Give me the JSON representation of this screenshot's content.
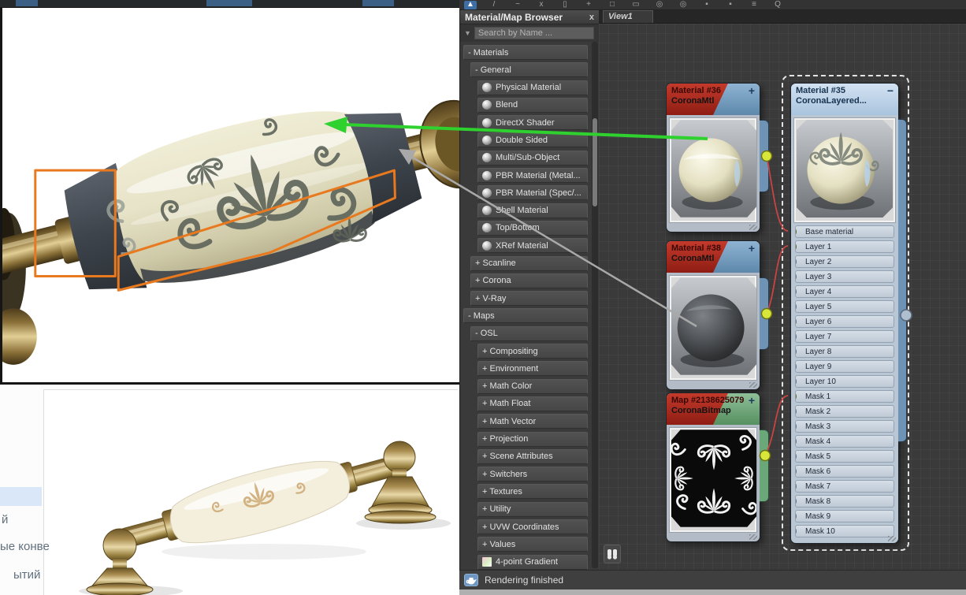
{
  "toolbar": {
    "icons": [
      {
        "name": "select-tool-icon",
        "glyph": "▲"
      },
      {
        "name": "move-tool-icon",
        "glyph": "/"
      },
      {
        "name": "pan-tool-icon",
        "glyph": "~"
      },
      {
        "name": "delete-icon",
        "glyph": "x"
      },
      {
        "name": "trash-icon",
        "glyph": "▯"
      },
      {
        "name": "connect-nodes-icon",
        "glyph": "+"
      },
      {
        "name": "layout-children-icon",
        "glyph": "□"
      },
      {
        "name": "select-region-icon",
        "glyph": "▭"
      },
      {
        "name": "render-map-icon",
        "glyph": "◎"
      },
      {
        "name": "render-material-icon",
        "glyph": "◎"
      },
      {
        "name": "show-grid-icon",
        "glyph": "▪"
      },
      {
        "name": "show-background-icon",
        "glyph": "▪"
      },
      {
        "name": "layout-all-icon",
        "glyph": "≡"
      },
      {
        "name": "zoom-tool-icon",
        "glyph": "Q"
      }
    ]
  },
  "browser": {
    "title": "Material/Map Browser",
    "close": "x",
    "search_placeholder": "Search by Name ...",
    "rows": [
      {
        "kind": "group",
        "label": "- Materials"
      },
      {
        "kind": "subgroup",
        "label": "- General"
      },
      {
        "kind": "material",
        "label": "Physical Material"
      },
      {
        "kind": "material",
        "label": "Blend"
      },
      {
        "kind": "material",
        "label": "DirectX Shader"
      },
      {
        "kind": "material",
        "label": "Double Sided"
      },
      {
        "kind": "material",
        "label": "Multi/Sub-Object"
      },
      {
        "kind": "material",
        "label": "PBR Material (Metal..."
      },
      {
        "kind": "material",
        "label": "PBR Material (Spec/..."
      },
      {
        "kind": "material",
        "label": "Shell Material"
      },
      {
        "kind": "material",
        "label": "Top/Bottom"
      },
      {
        "kind": "material",
        "label": "XRef Material"
      },
      {
        "kind": "collapsed",
        "label": "+ Scanline"
      },
      {
        "kind": "collapsed",
        "label": "+ Corona"
      },
      {
        "kind": "collapsed",
        "label": "+ V-Ray"
      },
      {
        "kind": "group",
        "label": "- Maps"
      },
      {
        "kind": "subgroup",
        "label": "- OSL"
      },
      {
        "kind": "collapsed2",
        "label": "+ Compositing"
      },
      {
        "kind": "collapsed2",
        "label": "+ Environment"
      },
      {
        "kind": "collapsed2",
        "label": "+ Math Color"
      },
      {
        "kind": "collapsed2",
        "label": "+ Math Float"
      },
      {
        "kind": "collapsed2",
        "label": "+ Math Vector"
      },
      {
        "kind": "collapsed2",
        "label": "+ Projection"
      },
      {
        "kind": "collapsed2",
        "label": "+ Scene Attributes"
      },
      {
        "kind": "collapsed2",
        "label": "+ Switchers"
      },
      {
        "kind": "collapsed2",
        "label": "+ Textures"
      },
      {
        "kind": "collapsed2",
        "label": "+ Utility"
      },
      {
        "kind": "collapsed2",
        "label": "+ UVW Coordinates"
      },
      {
        "kind": "collapsed2",
        "label": "+ Values"
      },
      {
        "kind": "gradient",
        "label": "4-point Gradient"
      }
    ]
  },
  "node_view": {
    "tab": "View1",
    "nodes": {
      "mat36": {
        "title": "Material #36",
        "subtitle": "CoronaMtl",
        "collapse_glyph": "+"
      },
      "mat38": {
        "title": "Material #38",
        "subtitle": "CoronaMtl",
        "collapse_glyph": "+"
      },
      "bitmap": {
        "title": "Map #2138625079",
        "subtitle": "CoronaBitmap",
        "collapse_glyph": "+"
      },
      "mat35": {
        "title": "Material #35",
        "subtitle": "CoronaLayered...",
        "collapse_glyph": "−",
        "slots": [
          {
            "label": "Base material",
            "connected": true
          },
          {
            "label": "Layer 1",
            "connected": true
          },
          {
            "label": "Layer 2",
            "connected": false
          },
          {
            "label": "Layer 3",
            "connected": false
          },
          {
            "label": "Layer 4",
            "connected": false
          },
          {
            "label": "Layer 5",
            "connected": false
          },
          {
            "label": "Layer 6",
            "connected": false
          },
          {
            "label": "Layer 7",
            "connected": false
          },
          {
            "label": "Layer 8",
            "connected": false
          },
          {
            "label": "Layer 9",
            "connected": false
          },
          {
            "label": "Layer 10",
            "connected": false
          },
          {
            "label": "Mask 1",
            "connected": true
          },
          {
            "label": "Mask 2",
            "connected": false
          },
          {
            "label": "Mask 3",
            "connected": false
          },
          {
            "label": "Mask 4",
            "connected": false
          },
          {
            "label": "Mask 5",
            "connected": false
          },
          {
            "label": "Mask 6",
            "connected": false
          },
          {
            "label": "Mask 7",
            "connected": false
          },
          {
            "label": "Mask 8",
            "connected": false
          },
          {
            "label": "Mask 9",
            "connected": false
          },
          {
            "label": "Mask 10",
            "connected": false
          }
        ]
      }
    }
  },
  "status_bar": {
    "text": "Rendering finished"
  },
  "page_fragments": {
    "line1": "й",
    "line2": "ые конве",
    "line3": "ытий"
  },
  "colors": {
    "green_arrow": "#2fd12f",
    "gray_arrow": "#a9a9a9",
    "orange_annotation": "#e8791e",
    "wire_red": "#c84444",
    "socket_yellow": "#d8e63a"
  }
}
